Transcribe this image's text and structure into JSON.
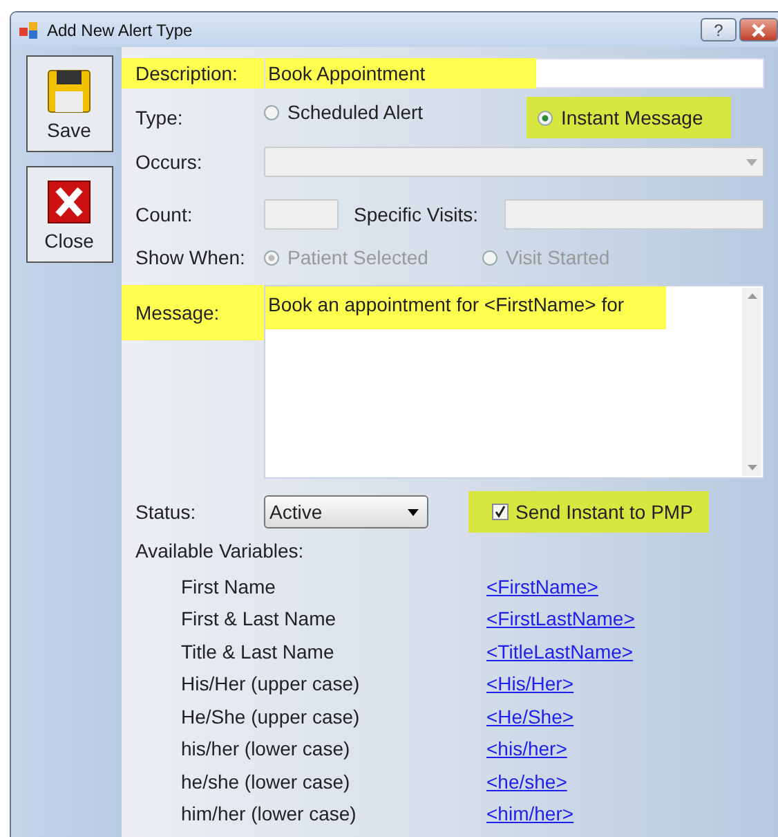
{
  "window": {
    "title": "Add New Alert Type",
    "help_button": "?"
  },
  "toolbar": [
    {
      "kind": "save",
      "label": "Save"
    },
    {
      "kind": "close",
      "label": "Close"
    }
  ],
  "description": {
    "label": "Description:",
    "value": "Book Appointment",
    "highlighted": true
  },
  "type": {
    "label": "Type:",
    "options": [
      {
        "label": "Scheduled Alert",
        "selected": false,
        "highlighted": false
      },
      {
        "label": "Instant Message",
        "selected": true,
        "highlighted": true
      }
    ]
  },
  "occurs": {
    "label": "Occurs:"
  },
  "count": {
    "label": "Count:"
  },
  "specific_visits": {
    "label": "Specific Visits:"
  },
  "show_when": {
    "label": "Show When:",
    "disabled": true,
    "options": [
      {
        "label": "Patient Selected",
        "selected": true
      },
      {
        "label": "Visit Started",
        "selected": false
      }
    ]
  },
  "message": {
    "label": "Message:",
    "value": "Book an appointment for <FirstName> for",
    "highlighted": true
  },
  "status": {
    "label": "Status:",
    "value": "Active"
  },
  "send_instant": {
    "label": "Send Instant to PMP",
    "checked": true,
    "highlighted": true
  },
  "variables": {
    "title": "Available Variables:",
    "items": [
      {
        "name": "First Name",
        "token": "<FirstName>"
      },
      {
        "name": "First & Last Name",
        "token": "<FirstLastName>"
      },
      {
        "name": "Title & Last Name",
        "token": "<TitleLastName>"
      },
      {
        "name": "His/Her (upper case)",
        "token": "<His/Her>"
      },
      {
        "name": "He/She (upper case)",
        "token": "<He/She>"
      },
      {
        "name": "his/her (lower case)",
        "token": "<his/her>"
      },
      {
        "name": "he/she (lower case)",
        "token": "<he/she>"
      },
      {
        "name": "him/her (lower case)",
        "token": "<him/her>"
      }
    ]
  }
}
